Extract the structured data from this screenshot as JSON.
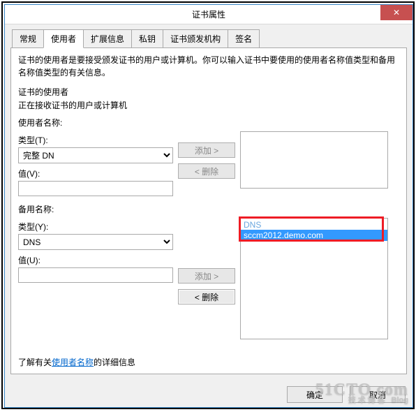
{
  "window": {
    "title": "证书属性",
    "close_glyph": "✕"
  },
  "tabs": [
    "常规",
    "使用者",
    "扩展信息",
    "私钥",
    "证书颁发机构",
    "签名"
  ],
  "active_tab_index": 1,
  "description": "证书的使用者是要接受颁发证书的用户或计算机。你可以输入证书中要使用的使用者名称值类型和备用名称值类型的有关信息。",
  "section_title": "证书的使用者",
  "section_sub": "正在接收证书的用户或计算机",
  "subject": {
    "group_label": "使用者名称:",
    "type_label": "类型(T):",
    "type_value": "完整 DN",
    "value_label": "值(V):",
    "value_value": "",
    "add_label": "添加 >",
    "remove_label": "< 删除"
  },
  "altname": {
    "group_label": "备用名称:",
    "type_label": "类型(Y):",
    "type_value": "DNS",
    "value_label": "值(U):",
    "value_value": "",
    "add_label": "添加 >",
    "remove_label": "< 删除",
    "entries": [
      {
        "kind": "DNS",
        "value": "sccm2012.demo.com"
      }
    ]
  },
  "footer_link_pre": "了解有关",
  "footer_link_text": "使用者名称",
  "footer_link_post": "的详细信息",
  "buttons": {
    "ok": "确定",
    "cancel": "取消"
  },
  "watermark": {
    "main": "51CTO.com",
    "sub": "技术博客",
    "blog": "Blog"
  }
}
